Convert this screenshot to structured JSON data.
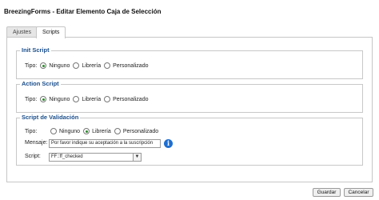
{
  "window": {
    "title": "BreezingForms - Editar Elemento Caja de Selección"
  },
  "tabs": [
    {
      "label": "Ajustes",
      "active": false
    },
    {
      "label": "Scripts",
      "active": true
    }
  ],
  "init_script": {
    "legend": "Init Script",
    "type_label": "Tipo:",
    "options": [
      "Ninguno",
      "Librería",
      "Personalizado"
    ],
    "selected": "Ninguno"
  },
  "action_script": {
    "legend": "Action Script",
    "type_label": "Tipo:",
    "options": [
      "Ninguno",
      "Librería",
      "Personalizado"
    ],
    "selected": "Ninguno"
  },
  "validation_script": {
    "legend": "Script de Validación",
    "type_label": "Tipo:",
    "options": [
      "Ninguno",
      "Librería",
      "Personalizado"
    ],
    "selected": "Librería",
    "message_label": "Mensaje:",
    "message_value": "Por favor indique su aceptación a la suscripción",
    "script_label": "Script:",
    "script_value": "FF::ff_checked"
  },
  "footer": {
    "save_label": "Guardar",
    "cancel_label": "Cancelar"
  },
  "colors": {
    "legend": "#1b4f8c",
    "radio_selected": "#2a8a2a",
    "info_icon": "#1f6fd0"
  },
  "icons": [
    "info-icon",
    "chevron-down-icon"
  ]
}
